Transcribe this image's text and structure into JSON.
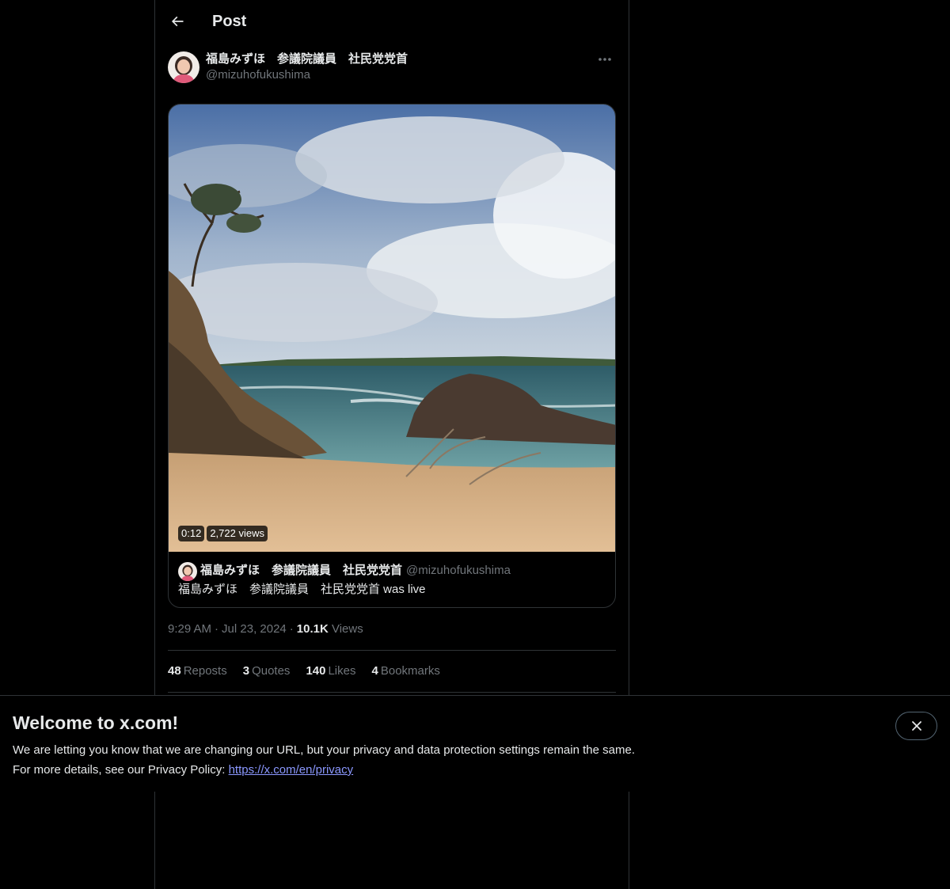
{
  "header": {
    "title": "Post",
    "back_icon": "arrow-left-icon"
  },
  "post": {
    "author_name": "福島みずほ　参議院議員　社民党党首",
    "author_handle": "@mizuhofukushima",
    "more_icon": "ellipsis-icon",
    "video": {
      "duration": "0:12",
      "views_badge": "2,722 views"
    },
    "live_card": {
      "name": "福島みずほ　参議院議員　社民党党首",
      "handle": "@mizuhofukushima",
      "text": "福島みずほ　参議院議員　社民党党首 was live"
    },
    "meta": {
      "time": "9:29 AM",
      "date": "Jul 23, 2024",
      "views_count": "10.1K",
      "views_label": "Views"
    },
    "stats": [
      {
        "count": "48",
        "label": "Reposts"
      },
      {
        "count": "3",
        "label": "Quotes"
      },
      {
        "count": "140",
        "label": "Likes"
      },
      {
        "count": "4",
        "label": "Bookmarks"
      }
    ]
  },
  "banner": {
    "title": "Welcome to x.com!",
    "line1": "We are letting you know that we are changing our URL, but your privacy and data protection settings remain the same.",
    "line2_prefix": "For more details, see our Privacy Policy: ",
    "link": "https://x.com/en/privacy",
    "close_icon": "close-icon"
  },
  "colors": {
    "background": "#000000",
    "text": "#e7e9ea",
    "muted": "#71767b",
    "border": "#2f3336",
    "link": "#8b98ff"
  }
}
